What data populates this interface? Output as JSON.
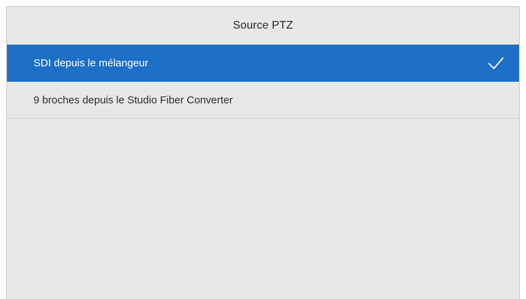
{
  "dialog": {
    "title": "Source PTZ"
  },
  "options": [
    {
      "label": "SDI depuis le mélangeur",
      "selected": true,
      "icon": "checkmark-icon"
    },
    {
      "label": "9 broches depuis le Studio Fiber Converter",
      "selected": false
    }
  ],
  "colors": {
    "selected_bg": "#1e6fc6",
    "panel_bg": "#e8e8e8",
    "text": "#2b2b2b"
  }
}
